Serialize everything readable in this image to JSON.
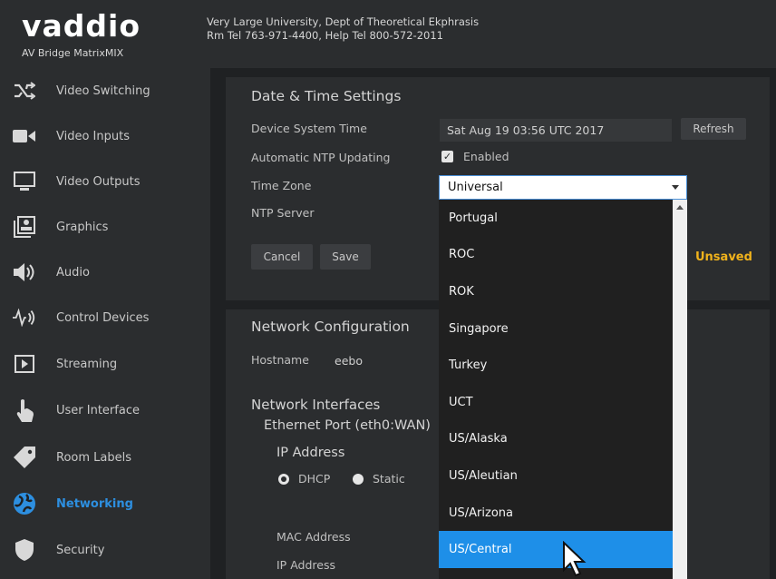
{
  "header": {
    "logo": "vaddio",
    "product": "AV Bridge MatrixMIX",
    "org_line1": "Very Large University, Dept of Theoretical Ekphrasis",
    "org_line2": "Rm Tel 763-971-4400, Help Tel 800-572-2011"
  },
  "sidebar": {
    "items": [
      {
        "label": "Video Switching",
        "icon": "shuffle-icon"
      },
      {
        "label": "Video Inputs",
        "icon": "camera-icon"
      },
      {
        "label": "Video Outputs",
        "icon": "monitor-icon"
      },
      {
        "label": "Graphics",
        "icon": "graphics-icon"
      },
      {
        "label": "Audio",
        "icon": "speaker-icon"
      },
      {
        "label": "Control Devices",
        "icon": "control-devices-icon"
      },
      {
        "label": "Streaming",
        "icon": "play-icon"
      },
      {
        "label": "User Interface",
        "icon": "hand-pointer-icon"
      },
      {
        "label": "Room Labels",
        "icon": "tag-icon"
      },
      {
        "label": "Networking",
        "icon": "globe-icon",
        "active": true
      },
      {
        "label": "Security",
        "icon": "shield-icon"
      }
    ]
  },
  "datetime": {
    "title": "Date & Time Settings",
    "system_time_label": "Device System Time",
    "system_time_value": "Sat Aug 19 03:56 UTC 2017",
    "refresh_label": "Refresh",
    "ntp_label": "Automatic NTP Updating",
    "ntp_checkbox_label": "Enabled",
    "timezone_label": "Time Zone",
    "timezone_value": "Universal",
    "ntp_server_label": "NTP Server",
    "cancel_label": "Cancel",
    "save_label": "Save",
    "unsaved_label": "Unsaved"
  },
  "network": {
    "title": "Network Configuration",
    "hostname_label": "Hostname",
    "hostname_value": "eebo",
    "interfaces_label": "Network Interfaces",
    "port_label": "Ethernet Port (eth0:WAN)",
    "ip_address_heading": "IP Address",
    "dhcp_label": "DHCP",
    "static_label": "Static",
    "mac_label": "MAC Address",
    "ip_label": "IP Address"
  },
  "timezone_options": [
    "Portugal",
    "ROC",
    "ROK",
    "Singapore",
    "Turkey",
    "UCT",
    "US/Alaska",
    "US/Aleutian",
    "US/Arizona",
    "US/Central"
  ],
  "timezone_selected": "US/Central",
  "colors": {
    "accent": "#2d8fe0",
    "selected_option": "#1e8fe8",
    "unsaved": "#f0b21c"
  }
}
